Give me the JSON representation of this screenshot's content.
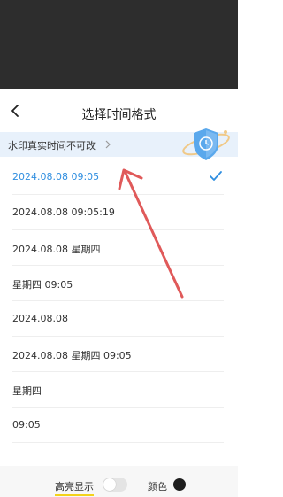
{
  "header": {
    "title": "选择时间格式",
    "back_icon": "chevron-left-icon"
  },
  "banner": {
    "text": "水印真实时间不可改",
    "chevron_icon": "chevron-right-icon",
    "illustration_icon": "shield-clock-icon"
  },
  "formats": [
    {
      "label": "2024.08.08 09:05",
      "selected": true
    },
    {
      "label": "2024.08.08 09:05:19",
      "selected": false
    },
    {
      "label": "2024.08.08 星期四",
      "selected": false
    },
    {
      "label": "星期四 09:05",
      "selected": false
    },
    {
      "label": "2024.08.08",
      "selected": false
    },
    {
      "label": "2024.08.08 星期四 09:05",
      "selected": false
    },
    {
      "label": "星期四",
      "selected": false
    },
    {
      "label": "09:05",
      "selected": false
    }
  ],
  "footer": {
    "highlight_label": "高亮显示",
    "highlight_on": false,
    "color_label": "颜色",
    "color_value": "#1e1e1e"
  },
  "colors": {
    "accent": "#2f8ee0",
    "annotation_arrow": "#e05a5a",
    "banner_bg": "#e8f1fb"
  }
}
